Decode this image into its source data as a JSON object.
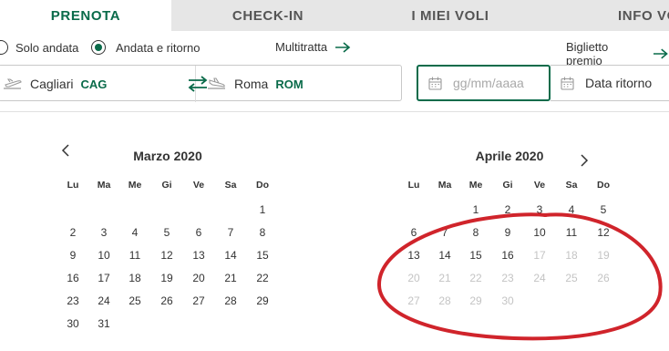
{
  "tabs": [
    {
      "label": "PRENOTA",
      "active": true
    },
    {
      "label": "CHECK-IN",
      "active": false
    },
    {
      "label": "I MIEI VOLI",
      "active": false
    },
    {
      "label": "INFO VO",
      "active": false
    }
  ],
  "trip_type": {
    "one_way": "Solo andata",
    "round_trip": "Andata e ritorno",
    "selected": "round_trip",
    "multi_city": "Multitratta",
    "award_ticket": "Biglietto premio"
  },
  "search": {
    "origin_city": "Cagliari",
    "origin_code": "CAG",
    "destination_city": "Roma",
    "destination_code": "ROM",
    "departure_placeholder": "gg/mm/aaaa",
    "departure_value": "",
    "return_label": "Data ritorno"
  },
  "calendar": {
    "weekdays": [
      "Lu",
      "Ma",
      "Me",
      "Gi",
      "Ve",
      "Sa",
      "Do"
    ],
    "months": [
      {
        "title": "Marzo 2020",
        "weeks": [
          [
            "",
            "",
            "",
            "",
            "",
            "",
            "1"
          ],
          [
            "2",
            "3",
            "4",
            "5",
            "6",
            "7",
            "8"
          ],
          [
            "9",
            "10",
            "11",
            "12",
            "13",
            "14",
            "15"
          ],
          [
            "16",
            "17",
            "18",
            "19",
            "20",
            "21",
            "22"
          ],
          [
            "23",
            "24",
            "25",
            "26",
            "27",
            "28",
            "29"
          ],
          [
            "30",
            "31",
            "",
            "",
            "",
            "",
            ""
          ]
        ]
      },
      {
        "title": "Aprile 2020",
        "weeks": [
          [
            "",
            "",
            "1",
            "2",
            "3",
            "4",
            "5"
          ],
          [
            "6",
            "7",
            "8",
            "9",
            "10",
            "11",
            "12"
          ],
          [
            "13",
            "14",
            "15",
            "16",
            "17",
            "18",
            "19"
          ],
          [
            "20",
            "21",
            "22",
            "23",
            "24",
            "25",
            "26"
          ],
          [
            "27",
            "28",
            "29",
            "30",
            "",
            "",
            ""
          ]
        ],
        "last_available_day": 16
      }
    ]
  },
  "colors": {
    "brand": "#0a6b4a",
    "annotation": "#d0242b",
    "disabled_text": "#c4c4c4"
  }
}
